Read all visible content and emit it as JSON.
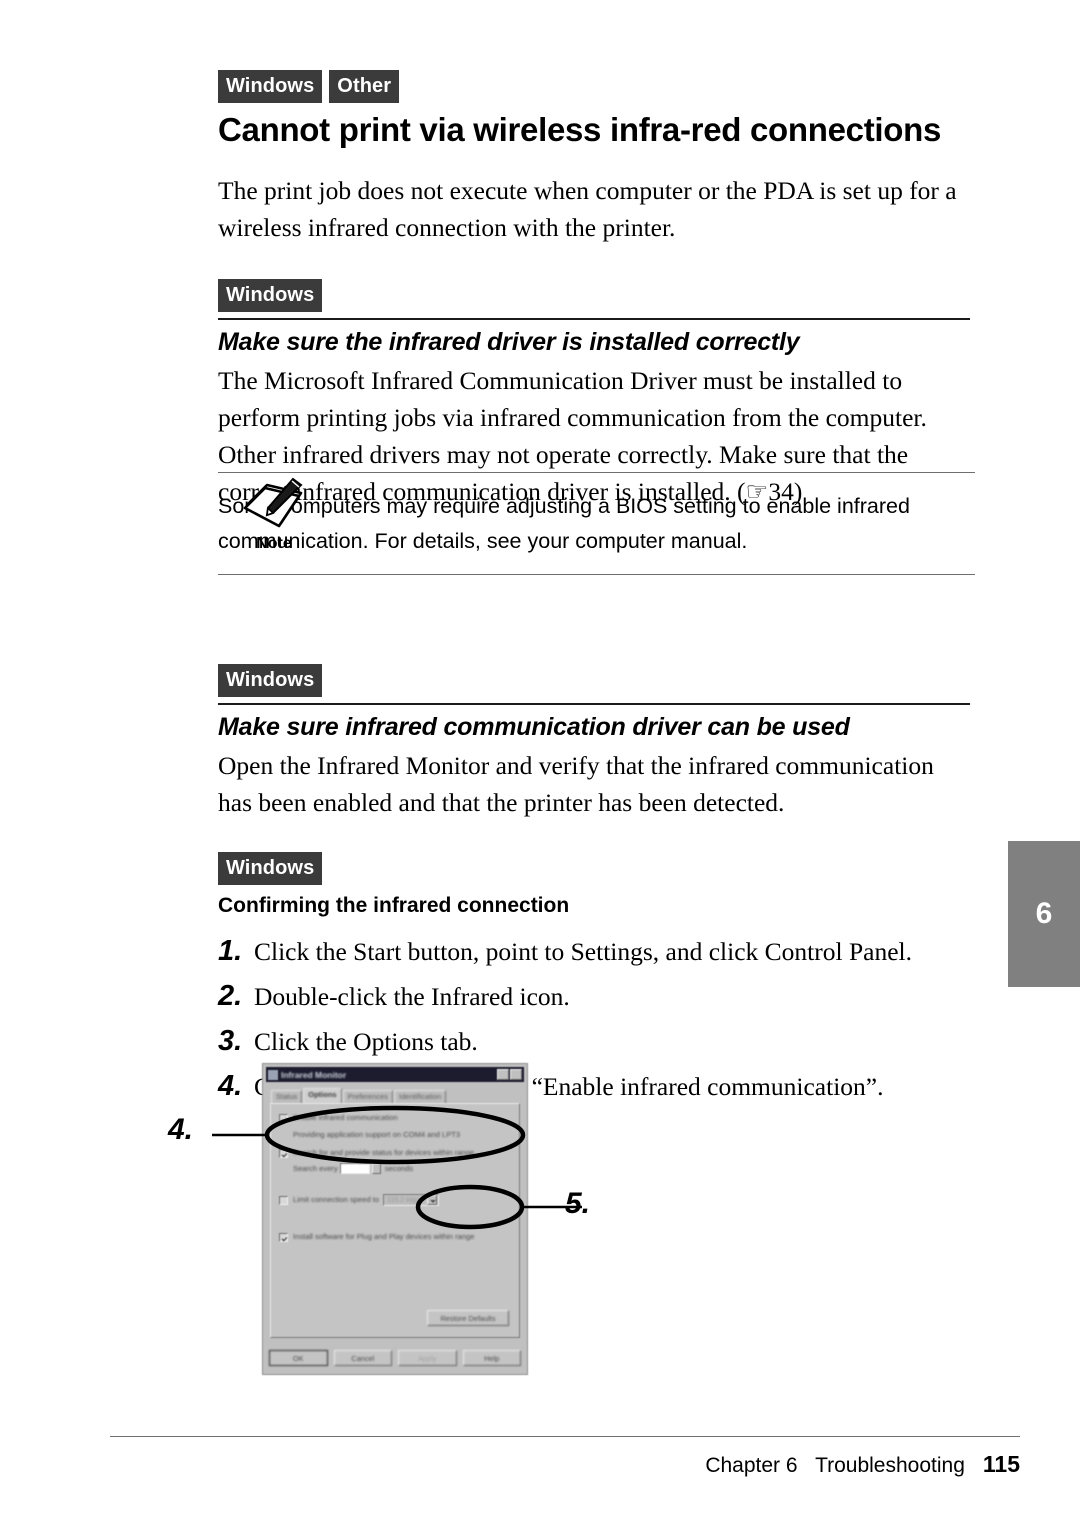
{
  "page": {
    "chapter_tab": "6"
  },
  "topic": {
    "badges": [
      "Windows",
      "Other"
    ],
    "title": "Cannot print via wireless infra-red connections",
    "intro": "The print job does not execute when computer or the PDA is set up for a wireless infrared connection with the printer."
  },
  "section1": {
    "badges": [
      "Windows"
    ],
    "heading": "Make sure the infrared driver is installed correctly",
    "body": "The Microsoft Infrared Communication Driver must be installed to perform printing jobs via infrared communication from the computer.  Other infrared drivers may not operate correctly.  Make sure that the correct infrared communication driver is installed. (☞34)"
  },
  "note": {
    "icon_label": "Note",
    "icon_name": "note-pencil-icon",
    "text": "Some computers may require adjusting a BIOS setting to enable infrared communication. For details, see your computer manual."
  },
  "section2": {
    "badges": [
      "Windows"
    ],
    "heading": "Make sure infrared communication driver can be used",
    "body": "Open the Infrared Monitor and verify that the infrared communication has been enabled and that the printer has been detected."
  },
  "procedure": {
    "badges": [
      "Windows"
    ],
    "heading": "Confirming the infrared connection",
    "steps": [
      {
        "num": "1.",
        "text": "Click the Start button, point to Settings, and click Control Panel."
      },
      {
        "num": "2.",
        "text": "Double-click the Infrared icon."
      },
      {
        "num": "3.",
        "text": "Click the Options tab."
      },
      {
        "num": "4.",
        "text": "Click the check box on for “Enable infrared communication”."
      }
    ]
  },
  "figure": {
    "callouts": [
      {
        "id": "4",
        "label": "4."
      },
      {
        "id": "5",
        "label": "5."
      }
    ],
    "dialog": {
      "title": "Infrared Monitor",
      "title_buttons": [
        "?",
        "×"
      ],
      "tabs": [
        {
          "label": "Status",
          "active": false
        },
        {
          "label": "Options",
          "active": true
        },
        {
          "label": "Preferences",
          "active": false
        },
        {
          "label": "Identification",
          "active": false
        }
      ],
      "options": [
        {
          "label": "Enable infrared communication",
          "checked": true
        },
        {
          "sub": "Providing application support on COM4 and LPT3"
        },
        {
          "label": "Search for and provide status for devices within range",
          "checked": true
        },
        {
          "inline_prefix": "Search every",
          "field_value": "",
          "inline_suffix": "seconds"
        },
        {
          "label": "Limit connection speed to",
          "checked": false,
          "combo_value": "115.2 kbps"
        },
        {
          "label": "Install software for Plug and Play devices within range",
          "checked": true
        }
      ],
      "restore_button": "Restore Defaults",
      "footer_buttons": [
        {
          "label": "OK",
          "style": "default"
        },
        {
          "label": "Cancel",
          "style": "normal"
        },
        {
          "label": "Apply",
          "style": "disabled"
        },
        {
          "label": "Help",
          "style": "normal"
        }
      ]
    }
  },
  "footer": {
    "chapter": "Chapter 6",
    "section": "Troubleshooting",
    "page_number": "115"
  }
}
